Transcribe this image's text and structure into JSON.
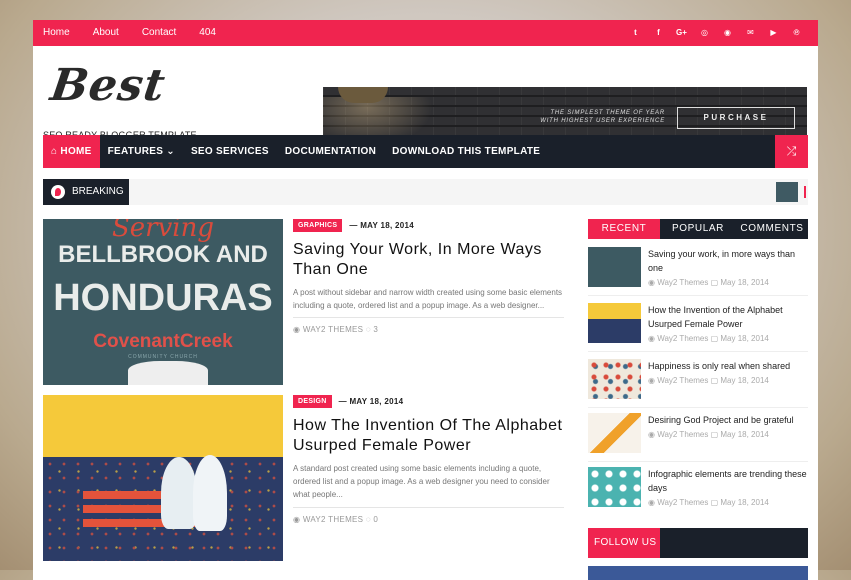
{
  "topbar": {
    "links": [
      "Home",
      "About",
      "Contact",
      "404"
    ],
    "social_icons": [
      "twitter-icon",
      "facebook-icon",
      "google-plus-icon",
      "instagram-icon",
      "rss-icon",
      "email-icon",
      "youtube-icon",
      "pinterest-icon"
    ],
    "social_glyphs": [
      "t",
      "f",
      "G+",
      "◎",
      "◉",
      "✉",
      "▶",
      "℗"
    ]
  },
  "header": {
    "logo": "Best",
    "tagline": "SEO READY BLOGGER TEMPLATE",
    "banner_text": "THE SIMPLEST THEME OF YEAR WITH HIGHEST USER EXPERIENCE",
    "banner_button": "PURCHASE"
  },
  "nav": {
    "home": "HOME",
    "features": "FEATURES",
    "seo": "SEO SERVICES",
    "docs": "DOCUMENTATION",
    "download": "DOWNLOAD THIS TEMPLATE"
  },
  "breaking": {
    "label": "BREAKING"
  },
  "posts": [
    {
      "tag": "GRAPHICS",
      "date": "MAY 18, 2014",
      "title": "Saving Your Work, In More Ways Than One",
      "excerpt": "A post without sidebar and narrow width created using some basic elements including a quote, ordered list and a popup image. As a web designer...",
      "author": "WAY2 THEMES",
      "comments": "3",
      "image_text": {
        "script": "Serving",
        "line1": "BELLBROOK AND",
        "line2": "HONDURAS",
        "line3": "CovenantCreek",
        "line4": "COMMUNITY CHURCH"
      }
    },
    {
      "tag": "DESIGN",
      "date": "MAY 18, 2014",
      "title": "How The Invention Of The Alphabet Usurped Female Power",
      "excerpt": "A standard post created using some basic elements including a quote, ordered list and a popup image. As a web designer you need to consider what people...",
      "author": "WAY2 THEMES",
      "comments": "0"
    }
  ],
  "sidebar": {
    "tabs": [
      "RECENT",
      "POPULAR",
      "COMMENTS"
    ],
    "items": [
      {
        "title": "Saving your work, in more ways than one",
        "author": "Way2 Themes",
        "date": "May 18, 2014"
      },
      {
        "title": "How the Invention of the Alphabet Usurped Female Power",
        "author": "Way2 Themes",
        "date": "May 18, 2014"
      },
      {
        "title": "Happiness is only real when shared",
        "author": "Way2 Themes",
        "date": "May 18, 2014"
      },
      {
        "title": "Desiring God Project and be grateful",
        "author": "Way2 Themes",
        "date": "May 18, 2014"
      },
      {
        "title": "Infographic elements are trending these days",
        "author": "Way2 Themes",
        "date": "May 18, 2014"
      }
    ],
    "follow": "FOLLOW US"
  },
  "colors": {
    "accent": "#f0244f",
    "dark": "#1a202a"
  }
}
